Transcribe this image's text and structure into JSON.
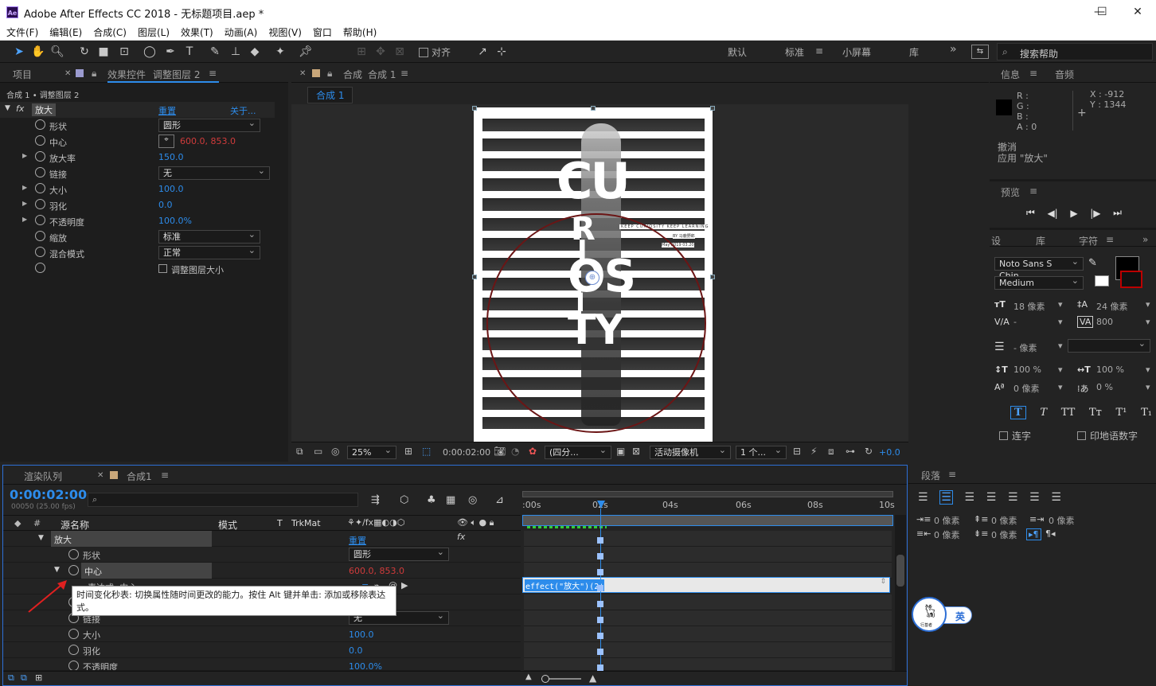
{
  "window": {
    "app_title": "Adobe After Effects CC 2018 - 无标题项目.aep *",
    "logo_text": "Ae",
    "minimize": "—",
    "maximize": "☐",
    "close": "✕"
  },
  "menu": [
    "文件(F)",
    "编辑(E)",
    "合成(C)",
    "图层(L)",
    "效果(T)",
    "动画(A)",
    "视图(V)",
    "窗口",
    "帮助(H)"
  ],
  "toolbar": {
    "snap_label": "对齐",
    "workspaces": [
      "默认",
      "标准",
      "小屏幕",
      "库"
    ],
    "active_workspace": "标准",
    "more": "»",
    "search_placeholder": "搜索帮助"
  },
  "left_panel": {
    "tab_project": "项目",
    "tab_effects_prefix": "效果控件",
    "tab_effects_layer": "调整图层 2",
    "breadcrumb": "合成 1 • 调整图层 2",
    "effect_name": "放大",
    "reset": "重置",
    "about": "关于...",
    "fx_icon": "fx",
    "properties": [
      {
        "label": "形状",
        "value": "圆形",
        "kind": "dropdown"
      },
      {
        "label": "中心",
        "value": "600.0, 853.0",
        "kind": "point"
      },
      {
        "label": "放大率",
        "value": "150.0",
        "kind": "number",
        "expand": true
      },
      {
        "label": "链接",
        "value": "无",
        "kind": "dropdown"
      },
      {
        "label": "大小",
        "value": "100.0",
        "kind": "number",
        "expand": true
      },
      {
        "label": "羽化",
        "value": "0.0",
        "kind": "number",
        "expand": true
      },
      {
        "label": "不透明度",
        "value": "100.0%",
        "kind": "number",
        "expand": true
      },
      {
        "label": "缩放",
        "value": "标准",
        "kind": "dropdown"
      },
      {
        "label": "混合模式",
        "value": "正常",
        "kind": "dropdown"
      },
      {
        "label": "",
        "value": "调整图层大小",
        "kind": "checkbox"
      }
    ]
  },
  "comp_panel": {
    "tab_prefix": "合成",
    "tab_name": "合成 1",
    "sub_tab": "合成 1",
    "poster_text_small": [
      "KEEP CURIOSITY KEEP LEARNING",
      "BY 马鹿野郎",
      "May 2019 03.20"
    ],
    "poster_letters": [
      "CU",
      "R",
      "I",
      "OS",
      "I",
      "TY"
    ],
    "zoom": "25%",
    "timecode": "0:00:02:00",
    "resolution": "(四分...",
    "camera": "活动摄像机",
    "views": "1 个...",
    "exposure": "+0.0"
  },
  "info_panel": {
    "tab_info": "信息",
    "tab_audio": "音频",
    "r": "R :",
    "g": "G :",
    "b": "B :",
    "a": "A : 0",
    "x": "X : -912",
    "y": "Y : 1344",
    "undo": "撤消",
    "applied": "应用 \"放大\"",
    "preview_tab": "预览"
  },
  "character_panel": {
    "tab_1": "设",
    "tab_2": "库",
    "tab_3": "字符",
    "font": "Noto Sans S Chin...",
    "style": "Medium",
    "size": "18 像素",
    "leading": "24 像素",
    "kerning": "-",
    "tracking": "800",
    "stroke": "- 像素",
    "vscale": "100 %",
    "hscale": "100 %",
    "baseline": "0 像素",
    "tsume": "0 %",
    "style_buttons": [
      "T",
      "T",
      "TT",
      "Tт",
      "T¹",
      "T₁"
    ],
    "ligature": "连字",
    "hindi": "印地语数字"
  },
  "timeline": {
    "tab_render": "渲染队列",
    "tab_comp": "合成1",
    "timecode": "0:00:02:00",
    "fps": "00050 (25.00 fps)",
    "search_placeholder": "",
    "col_hash": "#",
    "col_source": "源名称",
    "col_mode": "模式",
    "col_t": "T",
    "col_trkmat": "TrkMat",
    "ruler": [
      ":00s",
      "02s",
      "04s",
      "06s",
      "08s",
      "10s"
    ],
    "rows": [
      {
        "label": "放大",
        "value": "重置",
        "kind": "effect"
      },
      {
        "label": "形状",
        "value": "圆形",
        "kind": "dropdown"
      },
      {
        "label": "中心",
        "value": "600.0, 853.0",
        "kind": "point"
      },
      {
        "label": "表达式: 中心",
        "value": "",
        "kind": "expr"
      },
      {
        "label": "",
        "value": "",
        "kind": "blank"
      },
      {
        "label": "链接",
        "value": "无",
        "kind": "dropdown"
      },
      {
        "label": "大小",
        "value": "100.0",
        "kind": "number"
      },
      {
        "label": "羽化",
        "value": "0.0",
        "kind": "number"
      },
      {
        "label": "不透明度",
        "value": "100.0%",
        "kind": "number"
      }
    ],
    "expression": "effect(\"放大\")(2)",
    "tooltip": "时间变化秒表: 切换属性随时间更改的能力。按住 Alt 键并单击: 添加或移除表达式。"
  },
  "paragraph_panel": {
    "tab": "段落",
    "indent_left": "0 像素",
    "indent_right": "0 像素",
    "space_before": "0 像素",
    "space_after": "0 像素",
    "first_line": "0 像素"
  },
  "ime": {
    "badge": "行基者",
    "lang": "英"
  }
}
